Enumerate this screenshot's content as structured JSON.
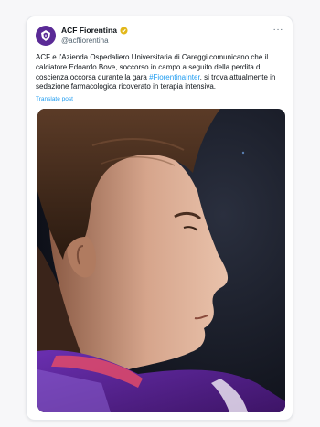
{
  "account": {
    "display_name": "ACF Fiorentina",
    "handle": "@acffiorentina",
    "avatar_icon": "fiorentina-crest-icon",
    "verified_icon": "verified-badge-icon",
    "more_icon": "more-options-icon"
  },
  "tweet": {
    "text_before": "ACF e l'Azienda Ospedaliero Universitaria di Careggi comunicano che il calciatore Edoardo Bove, soccorso in campo a seguito della perdita di coscienza occorsa durante la gara ",
    "hashtag": "#FiorentinaInter",
    "text_after": ", si trova attualmente in sedazione farmacologica ricoverato in terapia intensiva.",
    "translate_label": "Translate post"
  },
  "colors": {
    "accent": "#1d9bf0",
    "brand_purple": "#5a2a96"
  }
}
